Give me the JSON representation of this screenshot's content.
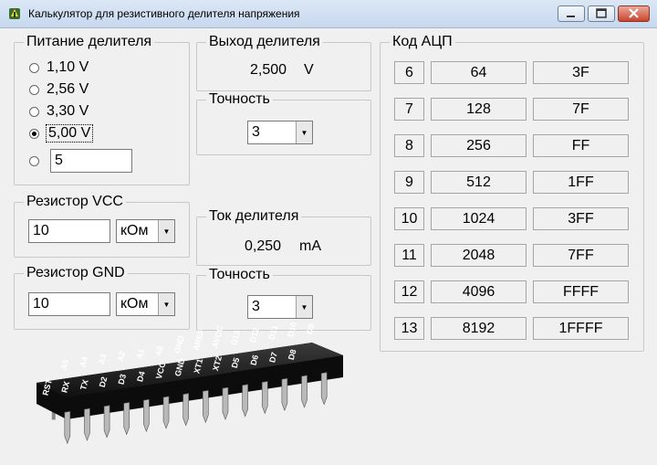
{
  "window": {
    "title": "Калькулятор для резистивного делителя напряжения"
  },
  "supply": {
    "label": "Питание делителя",
    "options": [
      "1,10 V",
      "2,56 V",
      "3,30 V",
      "5,00 V"
    ],
    "selected_index": 3,
    "custom_value": "5"
  },
  "output": {
    "label": "Выход делителя",
    "value": "2,500",
    "unit": "V",
    "precision_label": "Точность",
    "precision": "3"
  },
  "current": {
    "label": "Ток делителя",
    "value": "0,250",
    "unit": "mA",
    "precision_label": "Точность",
    "precision": "3"
  },
  "resistor_vcc": {
    "label": "Резистор VCC",
    "value": "10",
    "unit": "кОм"
  },
  "resistor_gnd": {
    "label": "Резистор GND",
    "value": "10",
    "unit": "кОм"
  },
  "adc": {
    "label": "Код АЦП",
    "rows": [
      {
        "bits": "6",
        "dec": "64",
        "hex": "3F"
      },
      {
        "bits": "7",
        "dec": "128",
        "hex": "7F"
      },
      {
        "bits": "8",
        "dec": "256",
        "hex": "FF"
      },
      {
        "bits": "9",
        "dec": "512",
        "hex": "1FF"
      },
      {
        "bits": "10",
        "dec": "1024",
        "hex": "3FF"
      },
      {
        "bits": "11",
        "dec": "2048",
        "hex": "7FF"
      },
      {
        "bits": "12",
        "dec": "4096",
        "hex": "FFFF"
      },
      {
        "bits": "13",
        "dec": "8192",
        "hex": "1FFFF"
      }
    ]
  },
  "chip_pins": {
    "top": [
      "A5",
      "A4",
      "A3",
      "A2",
      "A1",
      "A0",
      "GND",
      "AREF",
      "AVCC",
      "D13",
      "D12",
      "D11",
      "D10",
      "D9"
    ],
    "bottom": [
      "RST",
      "RX",
      "TX",
      "D2",
      "D3",
      "D4",
      "VCC",
      "GND",
      "XT1",
      "XT2",
      "D5",
      "D6",
      "D7",
      "D8"
    ]
  }
}
